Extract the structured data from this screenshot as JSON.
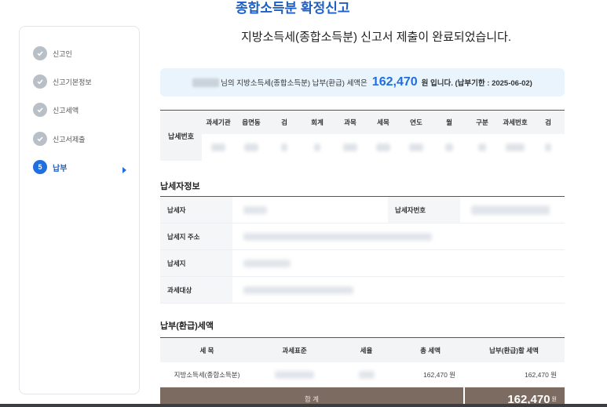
{
  "header": {
    "title": "종합소득분 확정신고",
    "complete_message": "지방소득세(종합소득분) 신고서 제출이 완료되었습니다."
  },
  "sidebar": {
    "steps": [
      {
        "label": "신고인",
        "state": "done"
      },
      {
        "label": "신고기본정보",
        "state": "done"
      },
      {
        "label": "신고세액",
        "state": "done"
      },
      {
        "label": "신고서제출",
        "state": "done"
      },
      {
        "number": "5",
        "label": "납부",
        "state": "active"
      }
    ]
  },
  "summary": {
    "text_before": "님의 지방소득세(종합소득분) 납부(환급) 세액은",
    "amount": "162,470",
    "text_after": "원 입니다. (납부기한 : 2025-06-02)"
  },
  "tax_number_table": {
    "row_header": "납세번호",
    "columns": [
      "과세기관",
      "읍면동",
      "검",
      "회계",
      "과목",
      "세목",
      "연도",
      "월",
      "구분",
      "과세번호",
      "검"
    ]
  },
  "taxpayer_section": {
    "title": "납세자정보",
    "labels": {
      "payer": "납세자",
      "payer_number": "납세자번호",
      "address": "납세지 주소",
      "tax_place": "납세지",
      "target": "과세대상"
    }
  },
  "payment_section": {
    "title": "납부(환급)세액",
    "headers": [
      "세 목",
      "과세표준",
      "세율",
      "총 세액",
      "납부(환급)할 세액"
    ],
    "rows": [
      {
        "item": "지방소득세(종합소득분)",
        "total": "162,470 원",
        "payable": "162,470 원"
      }
    ],
    "total_label": "합 계",
    "total_amount": "162,470",
    "total_unit": "원"
  },
  "colors": {
    "accent": "#1f6fe0",
    "title": "#1f5fc4",
    "info_bg": "#e9f4fc",
    "total_bg": "#7b6b60"
  }
}
